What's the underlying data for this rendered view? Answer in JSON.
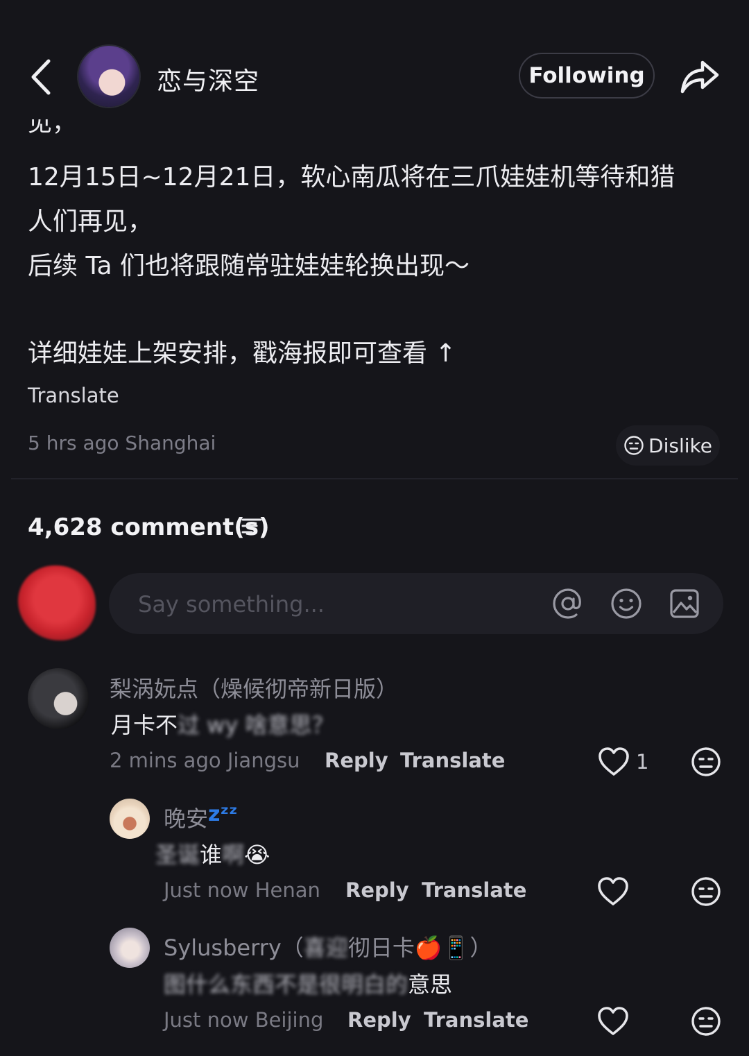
{
  "header": {
    "author_name": "恋与深空",
    "follow_label": "Following"
  },
  "post": {
    "cutoff_text": "见，",
    "lines": [
      "12月15日~12月21日，软心南瓜将在三爪娃娃机等待和猎",
      "人们再见，",
      "后续 Ta 们也将跟随常驻娃娃轮换出现～",
      "详细娃娃上架安排，戳海报即可查看 ↑"
    ],
    "translate_label": "Translate",
    "time_location": "5 hrs ago Shanghai",
    "dislike_label": "Dislike"
  },
  "comments_section": {
    "count_label": "4,628 comment(s)",
    "input_placeholder": "Say something...",
    "comments": [
      {
        "name": "梨涡妧点（燥候彻帝新日版）",
        "text_visible_start": "月卡不",
        "text_blurred": "过 wy 啥",
        "text_visible_end": "意思？",
        "time_location": "2 mins ago Jiangsu",
        "reply_label": "Reply",
        "translate_label": "Translate",
        "like_count": "1"
      },
      {
        "name": "晚安",
        "name_decoration": "zᶻᶻ",
        "text_blurred_start": "圣诞",
        "text_visible": "谁",
        "text_blurred_end": "啊",
        "emoji": "😭",
        "time_location": "Just now Henan",
        "reply_label": "Reply",
        "translate_label": "Translate"
      },
      {
        "name_visible_start": "Sylusberry（",
        "name_blurred": "喜迎",
        "name_visible_end": "彻日卡🍎📱）",
        "text_visible_start": "图",
        "text_blurred": "什么东西不是很明白的",
        "text_visible_end": "意思",
        "time_location": "Just now Beijing",
        "reply_label": "Reply",
        "translate_label": "Translate"
      }
    ]
  },
  "colors": {
    "background": "#15151a",
    "input_background": "#1f1f26",
    "muted_text": "#7a7a84",
    "avatar_red": "#d12a33"
  },
  "icons": [
    "back-arrow-icon",
    "share-icon",
    "dislike-face-icon",
    "sort-icon",
    "at-sign-icon",
    "emoji-icon",
    "image-icon",
    "heart-icon",
    "dislike-face-icon"
  ]
}
